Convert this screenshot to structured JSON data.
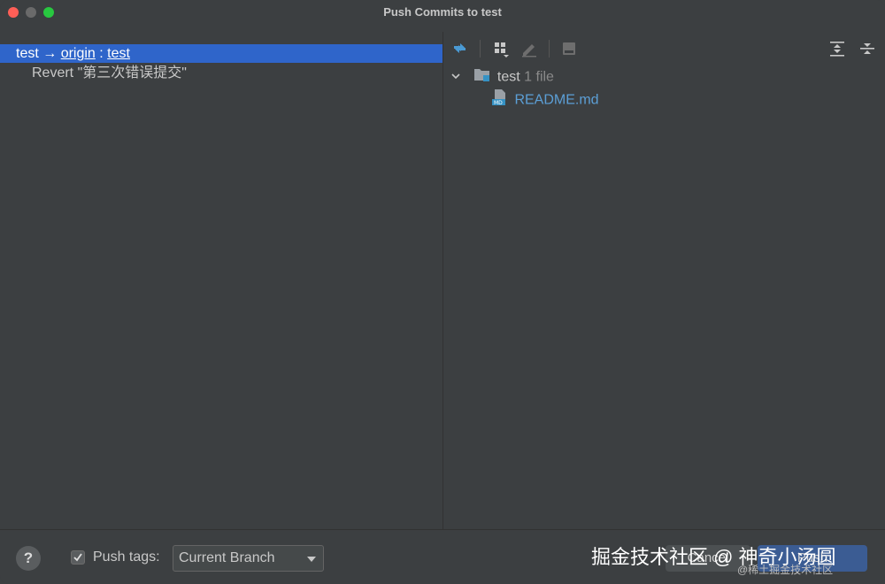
{
  "window": {
    "title": "Push Commits to test"
  },
  "left_panel": {
    "branch": {
      "local": "test",
      "arrow": " → ",
      "remote": "origin",
      "sep": " : ",
      "target": "test"
    },
    "commits": [
      {
        "message": "Revert \"第三次错误提交\""
      }
    ]
  },
  "right_panel": {
    "toolbar": {
      "icons": [
        "compare-arrows-icon",
        "group-by-icon",
        "edit-icon",
        "preview-icon",
        "expand-all-icon",
        "collapse-all-icon"
      ]
    },
    "tree": {
      "folder": {
        "name": "test",
        "count": "1 file"
      },
      "files": [
        {
          "name": "README.md",
          "type_badge": "MD"
        }
      ]
    }
  },
  "bottom_bar": {
    "help_label": "?",
    "push_tags": {
      "label": "Push tags:",
      "checked": true
    },
    "select": {
      "value": "Current Branch"
    },
    "cancel_label": "Cancel",
    "push_label": "Push"
  },
  "watermark": {
    "main": "掘金技术社区 @ 神奇小汤圆",
    "sub": "@稀土掘金技术社区"
  },
  "colors": {
    "selection": "#2f65ca",
    "link": "#5c9fd6",
    "background": "#3c3f41"
  }
}
